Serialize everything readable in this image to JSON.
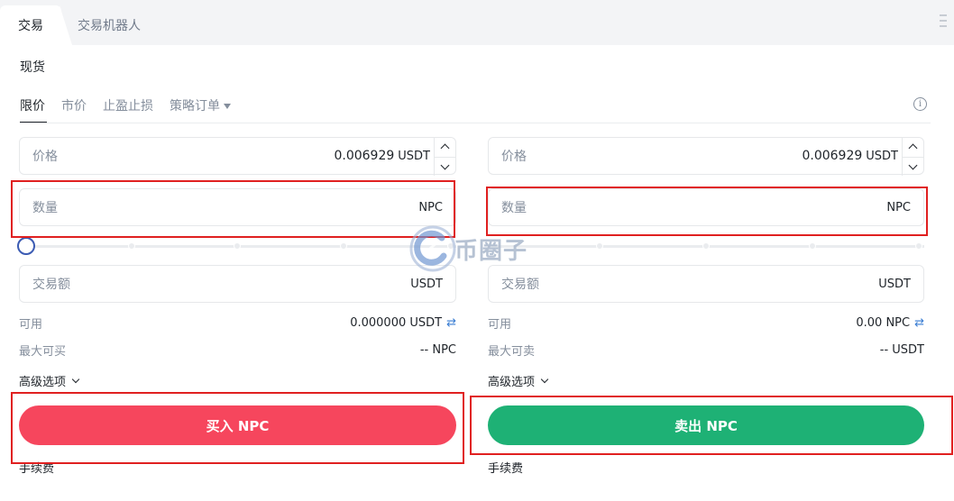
{
  "tabs": {
    "main": "交易",
    "robot": "交易机器人"
  },
  "section": {
    "spot": "现货"
  },
  "order_types": {
    "limit": "限价",
    "market": "市价",
    "tpsl": "止盈止损",
    "strategy": "策略订单"
  },
  "buy": {
    "price_label": "价格",
    "price_value": "0.006929",
    "price_unit": "USDT",
    "amount_label": "数量",
    "amount_unit": "NPC",
    "total_label": "交易额",
    "total_unit": "USDT",
    "available_label": "可用",
    "available_value": "0.000000 USDT",
    "max_label": "最大可买",
    "max_value": "-- NPC",
    "advanced": "高级选项",
    "button": "买入 NPC",
    "fee": "手续费"
  },
  "sell": {
    "price_label": "价格",
    "price_value": "0.006929",
    "price_unit": "USDT",
    "amount_label": "数量",
    "amount_unit": "NPC",
    "total_label": "交易额",
    "total_unit": "USDT",
    "available_label": "可用",
    "available_value": "0.00 NPC",
    "max_label": "最大可卖",
    "max_value": "-- USDT",
    "advanced": "高级选项",
    "button": "卖出 NPC",
    "fee": "手续费"
  },
  "slider": {
    "buy_percent": 0,
    "sell_percent": 0
  },
  "watermark": "币圈子",
  "icons": {
    "menu": "menu-icon",
    "info": "info-icon",
    "swap": "swap-icon",
    "caret": "caret-down-icon"
  },
  "colors": {
    "buy": "#f6465d",
    "sell": "#1eb175",
    "annotation": "#e02020"
  }
}
